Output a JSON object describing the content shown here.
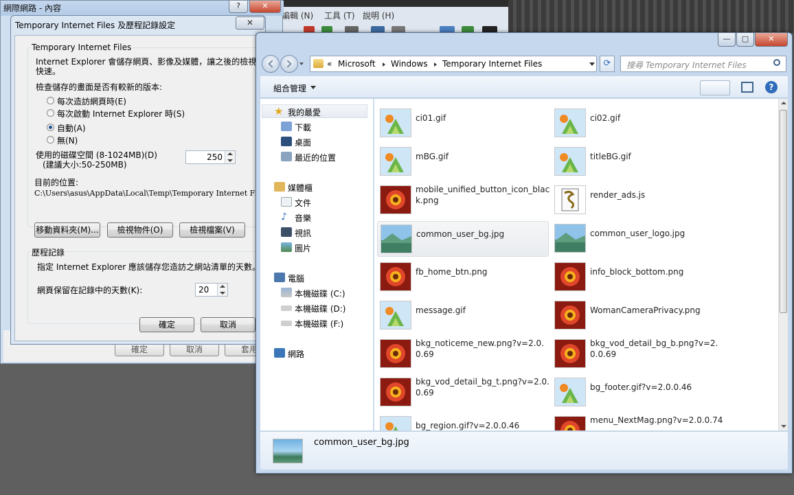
{
  "background_window": {
    "menu": [
      "編輯 (N)",
      "工具 (T)",
      "說明 (H)"
    ],
    "ghost_buttons": [
      "確定",
      "取消",
      "套用"
    ]
  },
  "inet_options": {
    "title": "網際網路 - 內容",
    "help": "?",
    "close": "✕"
  },
  "dialog": {
    "title": "Temporary Internet Files 及歷程記錄設定",
    "close": "✕",
    "tif_group": "Temporary Internet Files",
    "tif_desc_1": "Internet Explorer 會儲存網頁、影像及媒體，讓之後的檢視更",
    "tif_desc_2": "快速。",
    "check_label": "檢查儲存的畫面是否有較新的版本:",
    "radios": [
      "每次造訪網頁時(E)",
      "每次啟動 Internet Explorer 時(S)",
      "自動(A)",
      "無(N)"
    ],
    "selected_radio": "自動(A)",
    "disk_label_1": "使用的磁碟空間 (8-1024MB)(D)",
    "disk_label_2": "(建議大小:50-250MB)",
    "disk_value": "250",
    "location_label": "目前的位置:",
    "location_path": "C:\\Users\\asus\\AppData\\Local\\Temp\\Temporary Internet Files\\",
    "btn_move": "移動資料夾(M)...",
    "btn_objects": "檢視物件(O)",
    "btn_files": "檢視檔案(V)",
    "history_group": "歷程記錄",
    "history_desc": "指定 Internet Explorer 應該儲存您造訪之網站清單的天數。",
    "days_label": "網頁保留在記錄中的天數(K):",
    "days_value": "20",
    "ok": "確定",
    "cancel": "取消"
  },
  "explorer": {
    "caption": {
      "min": "—",
      "max": "□",
      "close": "✕"
    },
    "breadcrumb": [
      "«",
      "Microsoft",
      "Windows",
      "Temporary Internet Files"
    ],
    "search_placeholder": "搜尋 Temporary Internet Files",
    "organize": "組合管理",
    "nav": {
      "favorites": "我的最愛",
      "fav_items": [
        "下載",
        "桌面",
        "最近的位置"
      ],
      "libraries": "媒體櫃",
      "lib_items": [
        "文件",
        "音樂",
        "視訊",
        "圖片"
      ],
      "computer": "電腦",
      "drives": [
        "本機磁碟 (C:)",
        "本機磁碟 (D:)",
        "本機磁碟 (F:)"
      ],
      "network": "網路"
    },
    "files": [
      {
        "name": "ci01.gif",
        "kind": "gif"
      },
      {
        "name": "ci02.gif",
        "kind": "gif"
      },
      {
        "name": "mBG.gif",
        "kind": "gif"
      },
      {
        "name": "titleBG.gif",
        "kind": "gif"
      },
      {
        "name": "mobile_unified_button_icon_black.png",
        "kind": "png"
      },
      {
        "name": "render_ads.js",
        "kind": "js"
      },
      {
        "name": "common_user_bg.jpg",
        "kind": "jpg"
      },
      {
        "name": "common_user_logo.jpg",
        "kind": "jpg"
      },
      {
        "name": "fb_home_btn.png",
        "kind": "png"
      },
      {
        "name": "info_block_bottom.png",
        "kind": "png"
      },
      {
        "name": "message.gif",
        "kind": "gif"
      },
      {
        "name": "WomanCameraPrivacy.png",
        "kind": "png"
      },
      {
        "name": "bkg_noticeme_new.png?v=2.0.0.69",
        "kind": "png"
      },
      {
        "name": "bkg_vod_detail_bg_b.png?v=2.0.0.69",
        "kind": "png"
      },
      {
        "name": "bkg_vod_detail_bg_t.png?v=2.0.0.69",
        "kind": "png"
      },
      {
        "name": "bg_footer.gif?v=2.0.0.46",
        "kind": "gif"
      },
      {
        "name": "bg_region.gif?v=2.0.0.46",
        "kind": "gif"
      },
      {
        "name": "menu_NextMag.png?v=2.0.0.74",
        "kind": "png"
      }
    ],
    "selected_file": "common_user_bg.jpg",
    "details_name": "common_user_bg.jpg"
  },
  "colors": {
    "selection": "#e9ecef",
    "accent": "#1c4f8c"
  }
}
